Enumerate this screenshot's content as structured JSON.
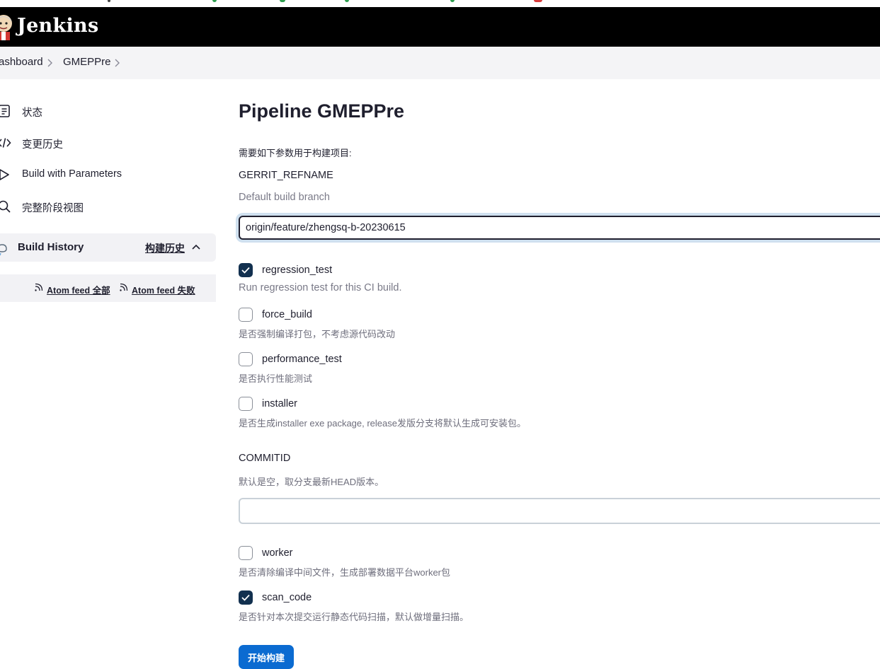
{
  "header": {
    "brand": "Jenkins"
  },
  "breadcrumb": {
    "items": [
      "ashboard",
      "GMEPPre"
    ]
  },
  "sidebar": {
    "items": [
      {
        "label": "状态",
        "icon": "document-icon"
      },
      {
        "label": "变更历史",
        "icon": "code-icon"
      },
      {
        "label": "Build with Parameters",
        "icon": "play-icon"
      },
      {
        "label": "完整阶段视图",
        "icon": "search-icon"
      }
    ],
    "build_history": {
      "title": "Build History",
      "link": "构建历史"
    },
    "feeds": {
      "all_label": "Atom feed 全部",
      "failed_label": "Atom feed 失败"
    }
  },
  "main": {
    "title": "Pipeline GMEPPre",
    "intro": "需要如下参数用于构建项目:",
    "gerrit": {
      "name": "GERRIT_REFNAME",
      "description": "Default build branch",
      "value": "origin/feature/zhengsq-b-20230615"
    },
    "checkboxes1": [
      {
        "label": "regression_test",
        "description": "Run regression test for this CI build.",
        "checked": true
      },
      {
        "label": "force_build",
        "description": "是否强制编译打包，不考虑源代码改动",
        "checked": false
      },
      {
        "label": "performance_test",
        "description": "是否执行性能测试",
        "checked": false
      },
      {
        "label": "installer",
        "description": "是否生成installer exe package, release发版分支将默认生成可安装包。",
        "checked": false
      }
    ],
    "commitid": {
      "name": "COMMITID",
      "description": "默认是空，取分支最新HEAD版本。",
      "value": ""
    },
    "checkboxes2": [
      {
        "label": "worker",
        "description": "是否清除编译中间文件，生成部署数据平台worker包",
        "checked": false
      },
      {
        "label": "scan_code",
        "description": "是否针对本次提交运行静态代码扫描，默认做增量扫描。",
        "checked": true
      }
    ],
    "submit_label": "开始构建"
  },
  "colors": {
    "header_bg": "#000000",
    "checkbox_checked": "#12304f",
    "primary_button": "#0b6bd1",
    "breadcrumb_bg": "#f4f4f6"
  }
}
